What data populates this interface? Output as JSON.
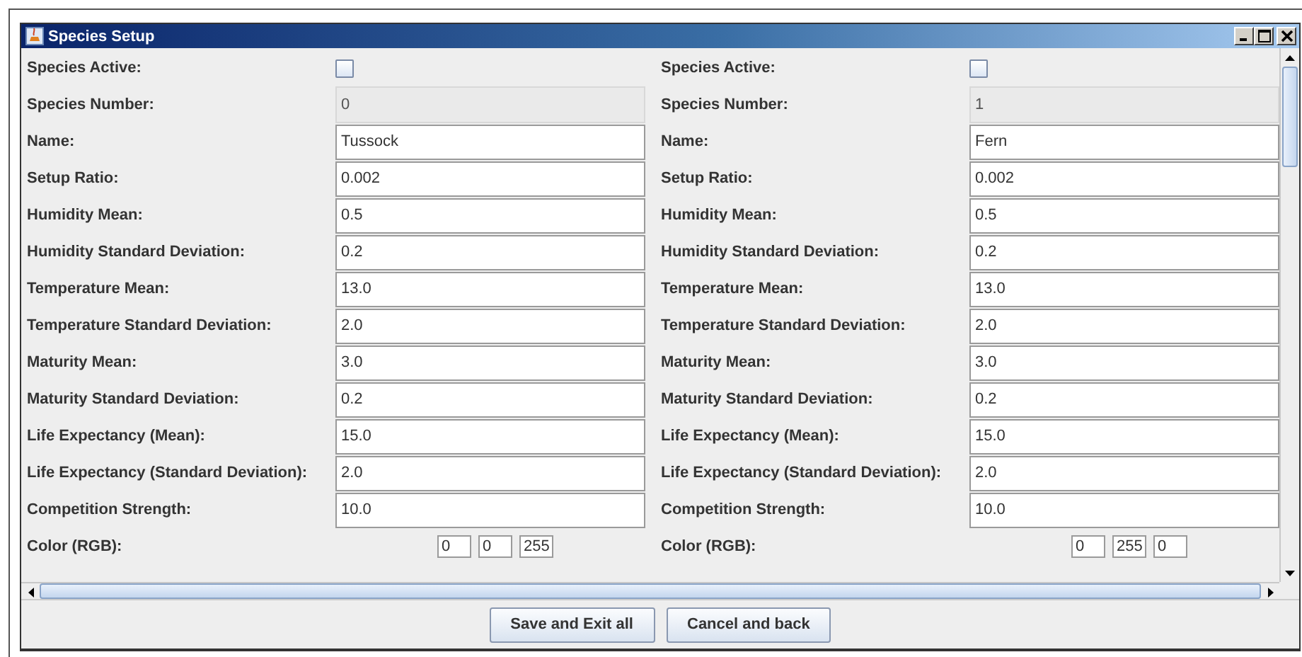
{
  "window": {
    "title": "Species Setup"
  },
  "species": [
    {
      "rows": [
        {
          "kind": "checkbox",
          "label": "Species Active:",
          "checked": false
        },
        {
          "kind": "readonly",
          "label": "Species Number:",
          "value": "0"
        },
        {
          "kind": "text",
          "label": "Name:",
          "value": "Tussock"
        },
        {
          "kind": "text",
          "label": "Setup Ratio:",
          "value": "0.002"
        },
        {
          "kind": "text",
          "label": "Humidity Mean:",
          "value": "0.5"
        },
        {
          "kind": "text",
          "label": "Humidity Standard Deviation:",
          "value": "0.2"
        },
        {
          "kind": "text",
          "label": "Temperature Mean:",
          "value": "13.0"
        },
        {
          "kind": "text",
          "label": "Temperature Standard Deviation:",
          "value": "2.0"
        },
        {
          "kind": "text",
          "label": "Maturity Mean:",
          "value": "3.0"
        },
        {
          "kind": "text",
          "label": "Maturity Standard Deviation:",
          "value": "0.2"
        },
        {
          "kind": "text",
          "label": "Life Expectancy (Mean):",
          "value": "15.0"
        },
        {
          "kind": "text",
          "label": "Life Expectancy (Standard Deviation):",
          "value": "2.0"
        },
        {
          "kind": "text",
          "label": "Competition Strength:",
          "value": "10.0"
        },
        {
          "kind": "rgb",
          "label": "Color (RGB):",
          "values": [
            "0",
            "0",
            "255"
          ]
        }
      ]
    },
    {
      "rows": [
        {
          "kind": "checkbox",
          "label": "Species Active:",
          "checked": false
        },
        {
          "kind": "readonly",
          "label": "Species Number:",
          "value": "1"
        },
        {
          "kind": "text",
          "label": "Name:",
          "value": "Fern"
        },
        {
          "kind": "text",
          "label": "Setup Ratio:",
          "value": "0.002"
        },
        {
          "kind": "text",
          "label": "Humidity Mean:",
          "value": "0.5"
        },
        {
          "kind": "text",
          "label": "Humidity Standard Deviation:",
          "value": "0.2"
        },
        {
          "kind": "text",
          "label": "Temperature Mean:",
          "value": "13.0"
        },
        {
          "kind": "text",
          "label": "Temperature Standard Deviation:",
          "value": "2.0"
        },
        {
          "kind": "text",
          "label": "Maturity Mean:",
          "value": "3.0"
        },
        {
          "kind": "text",
          "label": "Maturity Standard Deviation:",
          "value": "0.2"
        },
        {
          "kind": "text",
          "label": "Life Expectancy (Mean):",
          "value": "15.0"
        },
        {
          "kind": "text",
          "label": "Life Expectancy (Standard Deviation):",
          "value": "2.0"
        },
        {
          "kind": "text",
          "label": "Competition Strength:",
          "value": "10.0"
        },
        {
          "kind": "rgb",
          "label": "Color (RGB):",
          "values": [
            "0",
            "255",
            "0"
          ]
        }
      ]
    }
  ],
  "buttons": [
    {
      "label": "Save and Exit all"
    },
    {
      "label": "Cancel and back"
    }
  ]
}
